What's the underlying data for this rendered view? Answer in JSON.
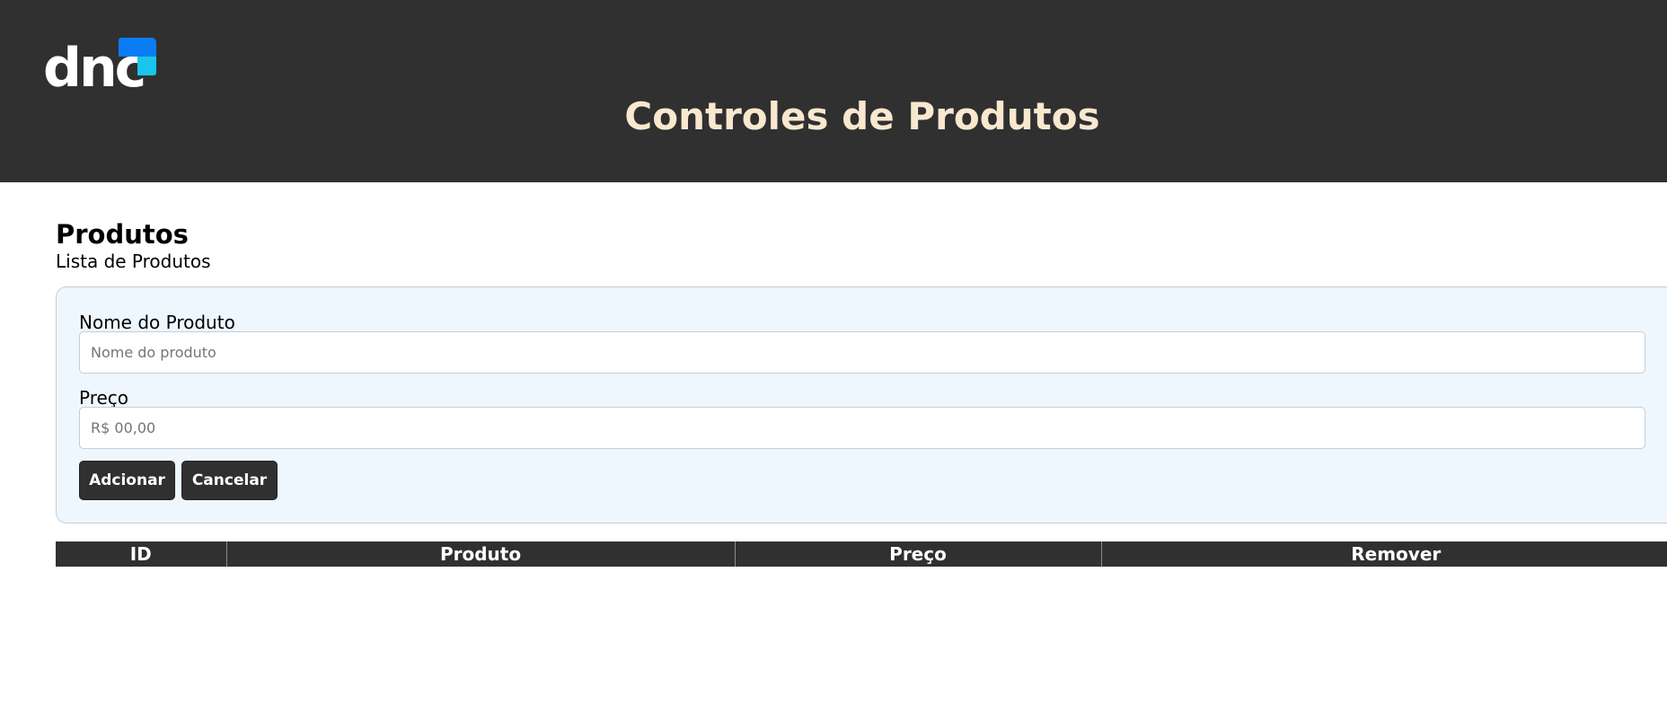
{
  "header": {
    "logo_text": "dnc",
    "title": "Controles de Produtos",
    "colors": {
      "background": "#303030",
      "title": "#f8e8cf",
      "logo_blue": "#0a7df5",
      "logo_cyan": "#18c5ec"
    }
  },
  "section": {
    "title": "Produtos",
    "subtitle": "Lista de Produtos"
  },
  "form": {
    "name_label": "Nome do Produto",
    "name_value": "",
    "name_placeholder": "Nome do produto",
    "price_label": "Preço",
    "price_value": "",
    "price_placeholder": "R$ 00,00",
    "add_label": "Adcionar",
    "cancel_label": "Cancelar",
    "colors": {
      "panel_background": "#eef6fe",
      "button_background": "#303030"
    }
  },
  "table": {
    "headers": [
      "ID",
      "Produto",
      "Preço",
      "Remover"
    ],
    "rows": []
  }
}
